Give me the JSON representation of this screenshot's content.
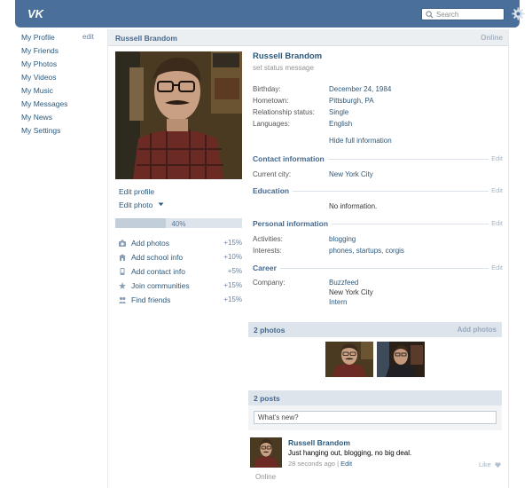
{
  "header": {
    "search_placeholder": "Search",
    "accent": "#4a6f9a"
  },
  "nav": {
    "items": [
      {
        "label": "My Profile",
        "name": "sidebar-item-my-profile"
      },
      {
        "label": "My Friends",
        "name": "sidebar-item-my-friends"
      },
      {
        "label": "My Photos",
        "name": "sidebar-item-my-photos"
      },
      {
        "label": "My Videos",
        "name": "sidebar-item-my-videos"
      },
      {
        "label": "My Music",
        "name": "sidebar-item-my-music"
      },
      {
        "label": "My Messages",
        "name": "sidebar-item-my-messages"
      },
      {
        "label": "My News",
        "name": "sidebar-item-my-news"
      },
      {
        "label": "My Settings",
        "name": "sidebar-item-my-settings"
      }
    ],
    "edit_label": "edit"
  },
  "profile": {
    "name": "Russell Brandom",
    "online": "Online",
    "status_placeholder": "set status message",
    "edit_profile": "Edit profile",
    "edit_photo": "Edit photo",
    "completion_percent": "40%",
    "completion_value": 0.4,
    "tasks": [
      {
        "label": "Add photos",
        "pct": "+15%",
        "icon": "camera-icon"
      },
      {
        "label": "Add school info",
        "pct": "+10%",
        "icon": "school-icon"
      },
      {
        "label": "Add contact info",
        "pct": "+5%",
        "icon": "phone-icon"
      },
      {
        "label": "Join communities",
        "pct": "+15%",
        "icon": "star-icon"
      },
      {
        "label": "Find friends",
        "pct": "+15%",
        "icon": "people-icon"
      }
    ]
  },
  "info": {
    "basic": [
      {
        "key": "Birthday:",
        "value": "December 24, 1984"
      },
      {
        "key": "Hometown:",
        "value": "Pittsburgh, PA"
      },
      {
        "key": "Relationship status:",
        "value": "Single"
      },
      {
        "key": "Languages:",
        "value": "English"
      }
    ],
    "hide_full": "Hide full information",
    "edit_label": "Edit",
    "contact_title": "Contact information",
    "contact": [
      {
        "key": "Current city:",
        "value": "New York City"
      }
    ],
    "education_title": "Education",
    "education_value": "No information.",
    "personal_title": "Personal information",
    "personal": [
      {
        "key": "Activities:",
        "value": "blogging"
      },
      {
        "key": "Interests:",
        "value": "phones, startups, corgis"
      }
    ],
    "career_title": "Career",
    "career_key": "Company:",
    "career_lines": [
      "Buzzfeed",
      "New York City",
      "Intern"
    ]
  },
  "photos": {
    "title": "2 photos",
    "add_label": "Add photos"
  },
  "posts": {
    "title": "2 posts",
    "whats_new_placeholder": "What's new?",
    "post": {
      "author": "Russell Brandom",
      "text": "Just hanging out, blogging, no big deal.",
      "time": "28 seconds ago",
      "edit": "Edit",
      "like": "Like"
    },
    "online_footer": "Online"
  }
}
